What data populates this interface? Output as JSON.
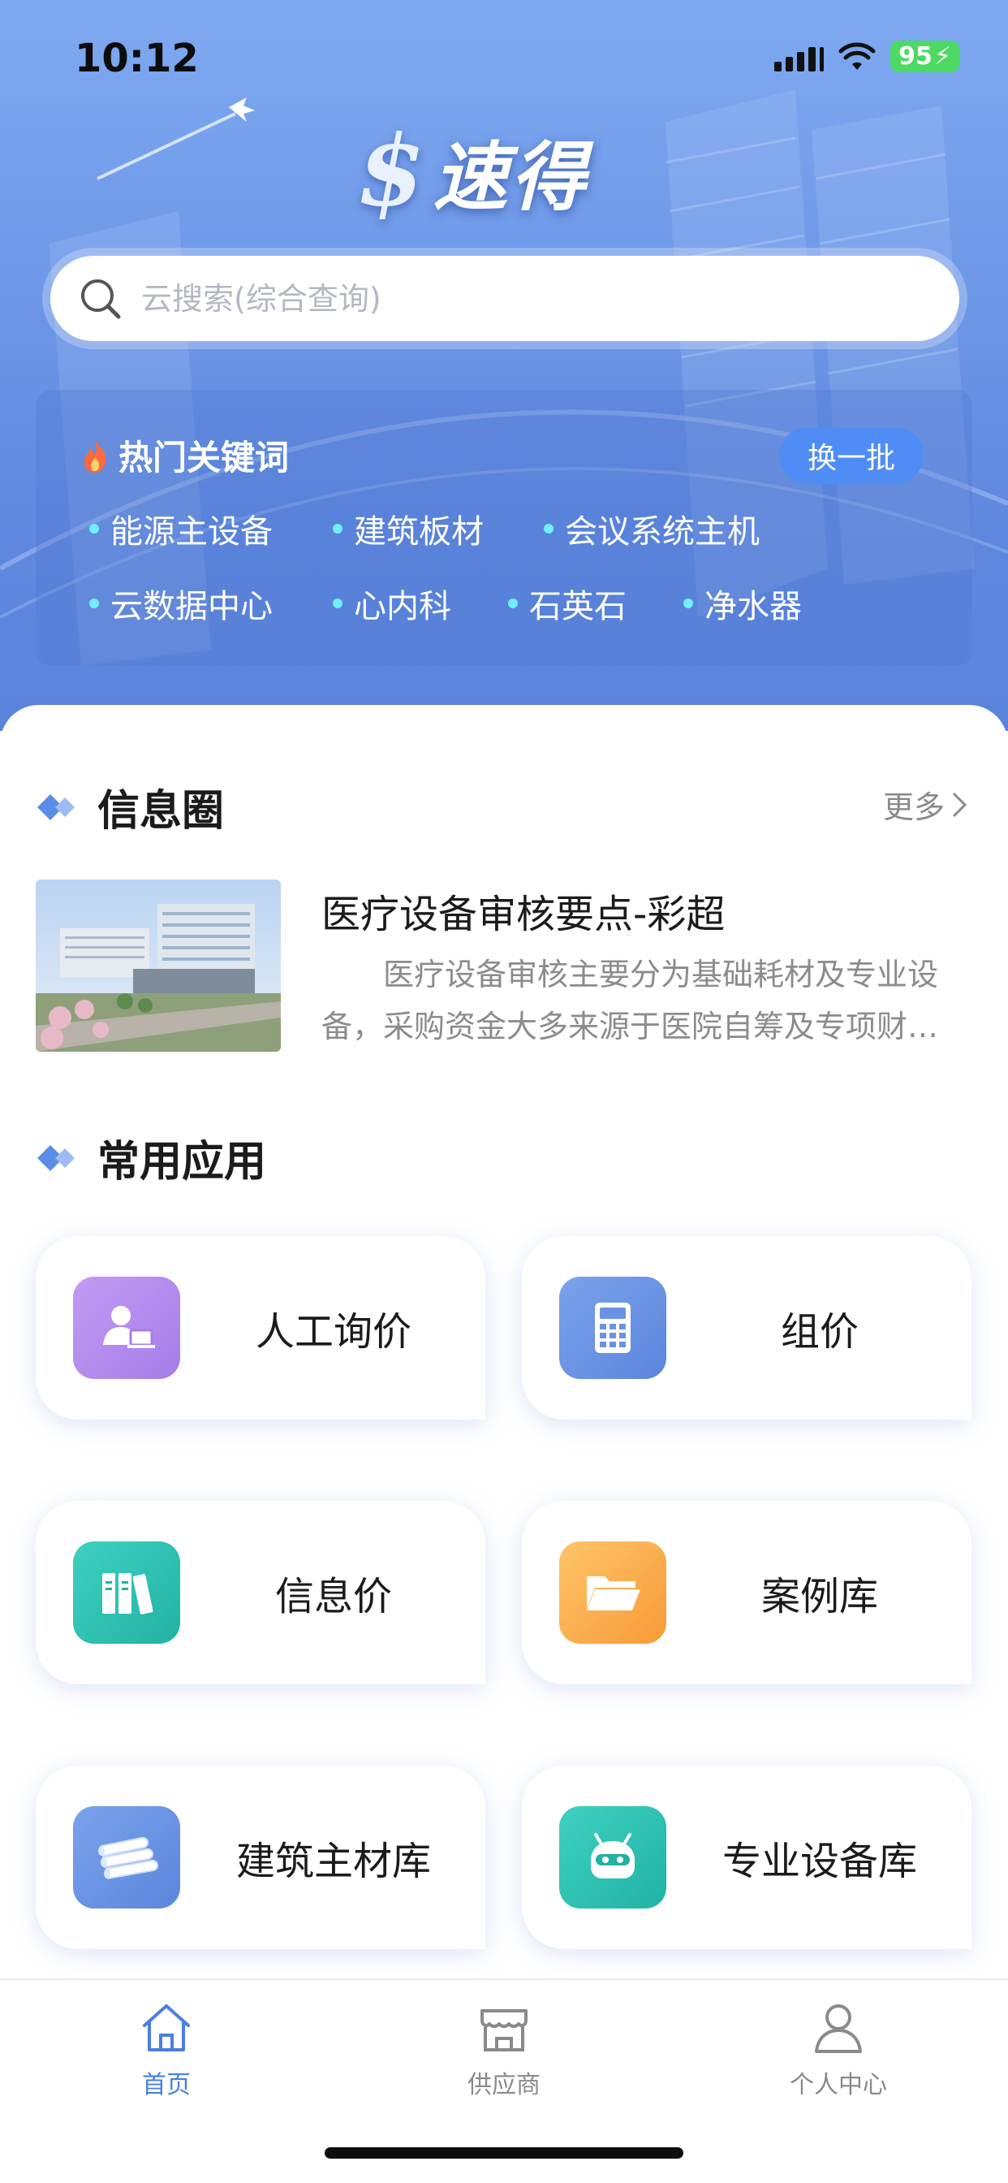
{
  "status_bar": {
    "time": "10:12",
    "battery": "95"
  },
  "app": {
    "logo_symbol": "$",
    "logo_text": "速得"
  },
  "search": {
    "placeholder": "云搜索(综合查询)"
  },
  "hot_keywords": {
    "title": "热门关键词",
    "refresh_label": "换一批",
    "items": [
      "能源主设备",
      "建筑板材",
      "会议系统主机",
      "云数据中心",
      "心内科",
      "石英石",
      "净水器"
    ]
  },
  "info_circle": {
    "title": "信息圈",
    "more_label": "更多",
    "article": {
      "title": "医疗设备审核要点-彩超",
      "summary": "医疗设备审核主要分为基础耗材及专业设备，采购资金大多来源于医院自筹及专项财政资金"
    }
  },
  "common_apps": {
    "title": "常用应用",
    "items": [
      {
        "label": "人工询价",
        "icon": "person-consultant-icon",
        "color": "#b58cf0"
      },
      {
        "label": "组价",
        "icon": "calculator-icon",
        "color": "#6b93e4"
      },
      {
        "label": "信息价",
        "icon": "books-icon",
        "color": "#2cc3b1"
      },
      {
        "label": "案例库",
        "icon": "folder-icon",
        "color": "#f8a94b"
      },
      {
        "label": "建筑主材库",
        "icon": "steel-pipes-icon",
        "color": "#6b93e4"
      },
      {
        "label": "专业设备库",
        "icon": "robot-icon",
        "color": "#2cc3b1"
      }
    ]
  },
  "tabbar": {
    "items": [
      {
        "label": "首页",
        "icon": "home-icon",
        "active": true
      },
      {
        "label": "供应商",
        "icon": "store-icon",
        "active": false
      },
      {
        "label": "个人中心",
        "icon": "user-icon",
        "active": false
      }
    ]
  },
  "colors": {
    "accent": "#4a7fe0",
    "hero": "#6f9ae9",
    "hot_button": "#4f8cf6"
  }
}
